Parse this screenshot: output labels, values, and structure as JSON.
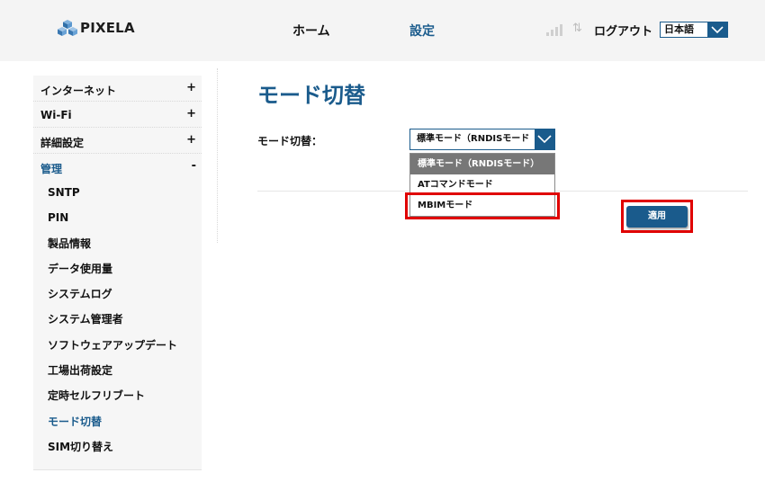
{
  "header": {
    "logo_text": "PIXELA",
    "nav": {
      "home": "ホーム",
      "settings": "設定"
    },
    "logout": "ログアウト",
    "language": "日本語",
    "colors": {
      "background": "#f4f4f4",
      "accent": "#1a5b8c"
    }
  },
  "sidebar": {
    "groups": [
      {
        "label": "インターネット",
        "toggle": "+"
      },
      {
        "label": "Wi-Fi",
        "toggle": "+"
      },
      {
        "label": "詳細設定",
        "toggle": "+"
      },
      {
        "label": "管理",
        "toggle": "-"
      }
    ],
    "sub_items": [
      "SNTP",
      "PIN",
      "製品情報",
      "データ使用量",
      "システムログ",
      "システム管理者",
      "ソフトウェアアップデート",
      "工場出荷設定",
      "定時セルフリブート",
      "モード切替",
      "SIM切り替え"
    ]
  },
  "main": {
    "title": "モード切替",
    "field_label": "モード切替：",
    "select_value": "標準モード（RNDISモード",
    "dropdown_options": [
      "標準モード（RNDISモード）",
      "ATコマンドモード",
      "MBIMモード"
    ],
    "apply_label": "適用"
  }
}
